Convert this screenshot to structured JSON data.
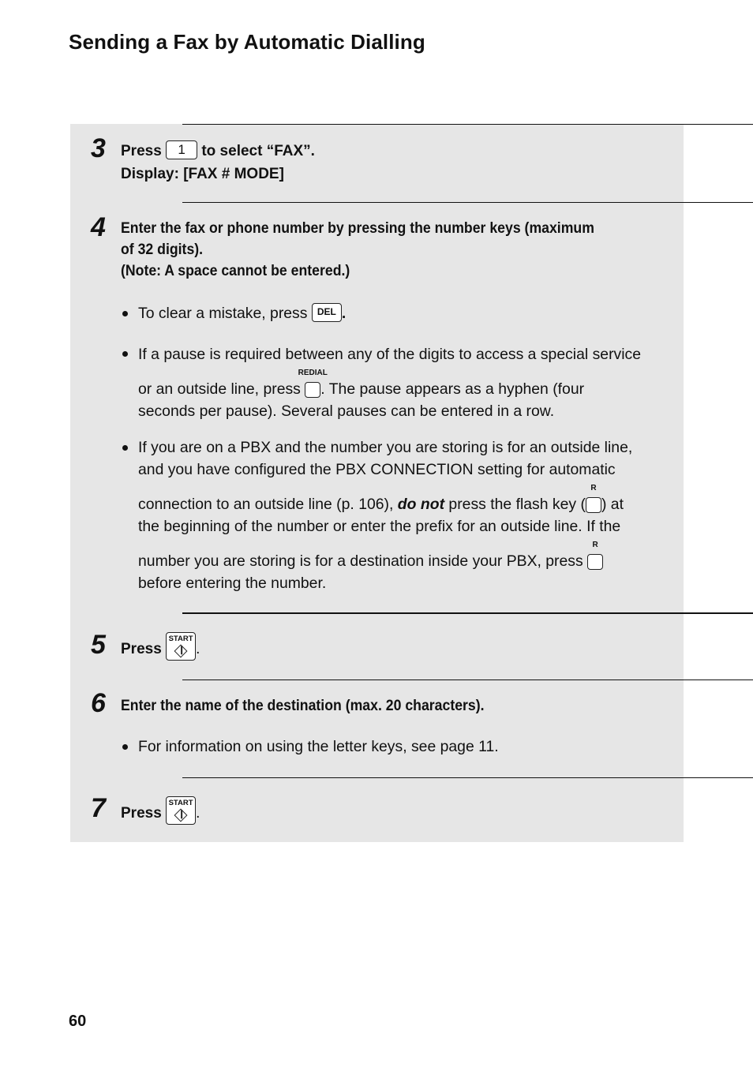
{
  "page": {
    "title": "Sending a Fax by Automatic Dialling",
    "page_number": "60"
  },
  "steps": [
    {
      "number": "3",
      "line1_before": "Press",
      "key": "1",
      "line1_after": "to select “FAX”.",
      "line2": "Display: [FAX # MODE]"
    },
    {
      "number": "4",
      "instruction_line1": "Enter the fax or phone number by pressing the number keys (maximum",
      "instruction_line2": "of 32 digits).",
      "note": "(Note: A space cannot be entered.)",
      "bullets": [
        {
          "before": "To clear a mistake, press",
          "key": "DEL",
          "after": "."
        },
        {
          "line1": "If a pause is required between any of the digits to access a special service",
          "line2_before": "or an outside line, press",
          "key_label": "REDIAL",
          "line2_after": ". The pause appears as a hyphen (four",
          "line3": "seconds per pause). Several pauses can be entered in a row."
        },
        {
          "line1": "If you are on a PBX and the number you are storing is for an outside line,",
          "line2": "and you have configured the PBX CONNECTION setting for automatic",
          "line3_before": "connection to an outside line (p. 106),",
          "line3_emphasis": "do not",
          "line3_mid": "press the flash key (",
          "key_label": "R",
          "line3_after": ") at",
          "line4": "the beginning of the number or enter the prefix for an outside line. If the",
          "line5_before": "number you are storing is for a destination inside your PBX, press",
          "key2_label": "R",
          "line6": "before entering the number."
        }
      ]
    },
    {
      "number": "5",
      "before": "Press",
      "key_label": "START",
      "after": "."
    },
    {
      "number": "6",
      "instruction": "Enter the name of the destination (max. 20 characters).",
      "bullets": [
        {
          "text": "For information on using the letter keys, see page 11."
        }
      ]
    },
    {
      "number": "7",
      "before": "Press",
      "key_label": "START",
      "after": "."
    }
  ]
}
